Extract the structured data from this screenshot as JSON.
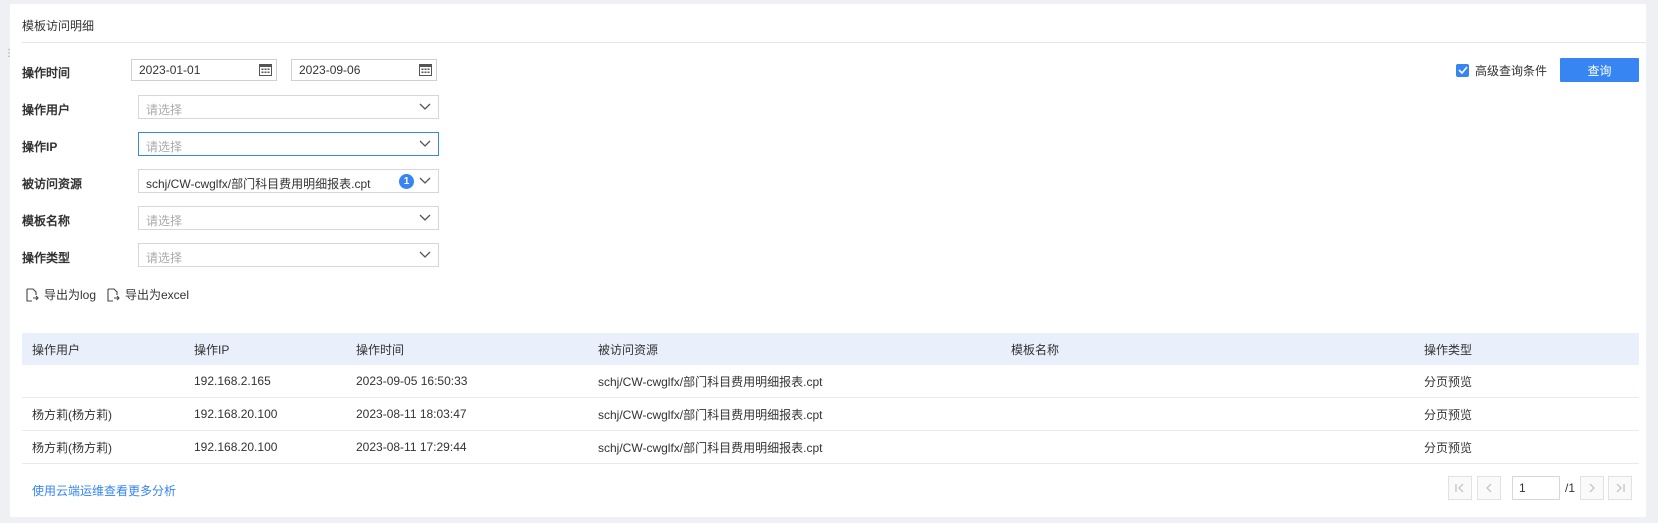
{
  "title": "模板访问明细",
  "filters": {
    "time_label": "操作时间",
    "date_from": "2023-01-01",
    "date_sep": "-",
    "date_to": "2023-09-06",
    "user_label": "操作用户",
    "user_placeholder": "请选择",
    "ip_label": "操作IP",
    "ip_placeholder": "请选择",
    "resource_label": "被访问资源",
    "resource_value": "schj/CW-cwglfx/部门科目费用明细报表.cpt",
    "resource_count": "1",
    "template_label": "模板名称",
    "template_placeholder": "请选择",
    "type_label": "操作类型",
    "type_placeholder": "请选择"
  },
  "advanced": {
    "label": "高级查询条件",
    "checked": true
  },
  "query_button": "查询",
  "export": {
    "log": "导出为log",
    "excel": "导出为excel"
  },
  "table": {
    "headers": [
      "操作用户",
      "操作IP",
      "操作时间",
      "被访问资源",
      "模板名称",
      "操作类型"
    ],
    "rows": [
      [
        "",
        "192.168.2.165",
        "2023-09-05 16:50:33",
        "schj/CW-cwglfx/部门科目费用明细报表.cpt",
        "",
        "分页预览"
      ],
      [
        "杨方莉(杨方莉)",
        "192.168.20.100",
        "2023-08-11 18:03:47",
        "schj/CW-cwglfx/部门科目费用明细报表.cpt",
        "",
        "分页预览"
      ],
      [
        "杨方莉(杨方莉)",
        "192.168.20.100",
        "2023-08-11 17:29:44",
        "schj/CW-cwglfx/部门科目费用明细报表.cpt",
        "",
        "分页预览"
      ]
    ]
  },
  "footer": {
    "link": "使用云端运维查看更多分析",
    "page_current": "1",
    "page_total": "/1"
  },
  "colors": {
    "accent": "#3685f2",
    "header_bg": "#e9f0fb"
  }
}
